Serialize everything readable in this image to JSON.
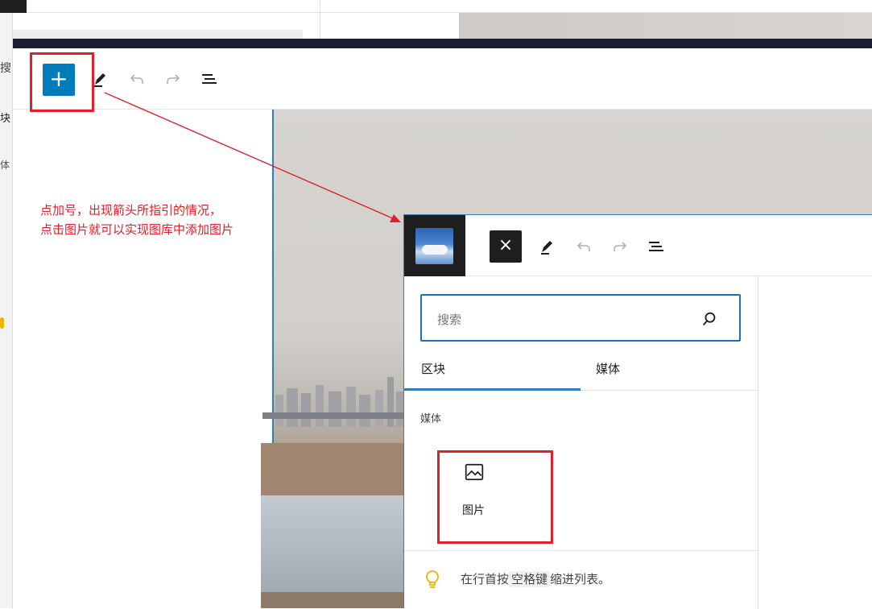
{
  "background": {
    "left_search_fragment": "搜",
    "left_block_fragment": "块",
    "left_media_fragment": "体"
  },
  "editor": {
    "add_button_glyph": "+",
    "toolbar_icons": [
      "pencil-icon",
      "undo-icon",
      "redo-icon",
      "document-overview-icon"
    ]
  },
  "annotation": {
    "line1": "点加号，出现箭头所指引的情况，",
    "line2": "点击图片就可以实现图库中添加图片",
    "color": "#e0202a"
  },
  "inserter": {
    "close_glyph": "×",
    "search": {
      "placeholder": "搜索"
    },
    "tabs": [
      {
        "label": "区块",
        "active": true
      },
      {
        "label": "媒体",
        "active": false
      }
    ],
    "section_label": "媒体",
    "block_item": {
      "label": "图片",
      "icon": "image-icon"
    },
    "tip": {
      "before": "在行首按",
      "key": "空格键",
      "after": "缩进列表。"
    }
  },
  "colors": {
    "accent": "#007cba",
    "dark": "#1e1e1e",
    "highlight_border": "#e0202a",
    "tab_active": "#2f7fb8"
  }
}
